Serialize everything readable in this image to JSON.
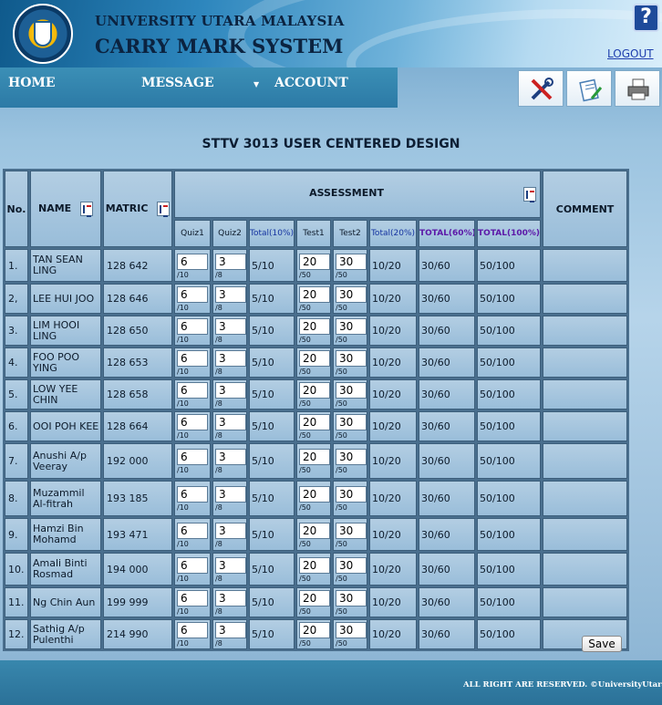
{
  "header": {
    "university": "UNIVERSITY UTARA MALAYSIA",
    "system": "CARRY MARK SYSTEM",
    "help_glyph": "?",
    "logout": "LOGOUT"
  },
  "nav": {
    "home": "HOME",
    "message": "MESSAGE",
    "account": "ACCOUNT"
  },
  "toolbar": {
    "icons": [
      "tools-icon",
      "document-edit-icon",
      "printer-icon"
    ]
  },
  "page": {
    "title": "STTV 3013 USER CENTERED DESIGN"
  },
  "table": {
    "headers": {
      "no": "No.",
      "name": "NAME",
      "matric": "MATRIC",
      "assessment": "ASSESSMENT",
      "comment": "COMMENT",
      "quiz1": "Quiz1",
      "quiz2": "Quiz2",
      "total10": "Total(10%)",
      "test1": "Test1",
      "test2": "Test2",
      "total20": "Total(20%)",
      "total60": "TOTAL(60%)",
      "total100": "TOTAL(100%)"
    },
    "max": {
      "quiz1": "/10",
      "quiz2": "/8",
      "test1": "/50",
      "test2": "/50"
    },
    "rows": [
      {
        "no": "1.",
        "name": "TAN SEAN LING",
        "matric": "128 642",
        "quiz1": "6",
        "quiz2": "3",
        "total10": "5/10",
        "test1": "20",
        "test2": "30",
        "total20": "10/20",
        "total60": "30/60",
        "total100": "50/100"
      },
      {
        "no": "2,",
        "name": "LEE HUI JOO",
        "matric": "128 646",
        "quiz1": "6",
        "quiz2": "3",
        "total10": "5/10",
        "test1": "20",
        "test2": "30",
        "total20": "10/20",
        "total60": "30/60",
        "total100": "50/100"
      },
      {
        "no": "3.",
        "name": "LIM HOOI LING",
        "matric": "128 650",
        "quiz1": "6",
        "quiz2": "3",
        "total10": "5/10",
        "test1": "20",
        "test2": "30",
        "total20": "10/20",
        "total60": "30/60",
        "total100": "50/100"
      },
      {
        "no": "4.",
        "name": "FOO POO YING",
        "matric": "128 653",
        "quiz1": "6",
        "quiz2": "3",
        "total10": "5/10",
        "test1": "20",
        "test2": "30",
        "total20": "10/20",
        "total60": "30/60",
        "total100": "50/100"
      },
      {
        "no": "5.",
        "name": "LOW YEE CHIN",
        "matric": "128 658",
        "quiz1": "6",
        "quiz2": "3",
        "total10": "5/10",
        "test1": "20",
        "test2": "30",
        "total20": "10/20",
        "total60": "30/60",
        "total100": "50/100"
      },
      {
        "no": "6.",
        "name": "OOI POH KEE",
        "matric": "128 664",
        "quiz1": "6",
        "quiz2": "3",
        "total10": "5/10",
        "test1": "20",
        "test2": "30",
        "total20": "10/20",
        "total60": "30/60",
        "total100": "50/100"
      },
      {
        "no": "7.",
        "name": "Anushi A/p Veeray",
        "matric": "192 000",
        "quiz1": "6",
        "quiz2": "3",
        "total10": "5/10",
        "test1": "20",
        "test2": "30",
        "total20": "10/20",
        "total60": "30/60",
        "total100": "50/100"
      },
      {
        "no": "8.",
        "name": "Muzammil Al-fitrah",
        "matric": "193 185",
        "quiz1": "6",
        "quiz2": "3",
        "total10": "5/10",
        "test1": "20",
        "test2": "30",
        "total20": "10/20",
        "total60": "30/60",
        "total100": "50/100"
      },
      {
        "no": "9.",
        "name": "Hamzi Bin Mohamd",
        "matric": "193 471",
        "quiz1": "6",
        "quiz2": "3",
        "total10": "5/10",
        "test1": "20",
        "test2": "30",
        "total20": "10/20",
        "total60": "30/60",
        "total100": "50/100"
      },
      {
        "no": "10.",
        "name": "Amali Binti Rosmad",
        "matric": "194 000",
        "quiz1": "6",
        "quiz2": "3",
        "total10": "5/10",
        "test1": "20",
        "test2": "30",
        "total20": "10/20",
        "total60": "30/60",
        "total100": "50/100"
      },
      {
        "no": "11.",
        "name": "Ng Chin Aun",
        "matric": "199 999",
        "quiz1": "6",
        "quiz2": "3",
        "total10": "5/10",
        "test1": "20",
        "test2": "30",
        "total20": "10/20",
        "total60": "30/60",
        "total100": "50/100"
      },
      {
        "no": "12.",
        "name": "Sathig A/p Pulenthi",
        "matric": "214 990",
        "quiz1": "6",
        "quiz2": "3",
        "total10": "5/10",
        "test1": "20",
        "test2": "30",
        "total20": "10/20",
        "total60": "30/60",
        "total100": "50/100"
      }
    ]
  },
  "actions": {
    "save": "Save"
  },
  "footer": {
    "text": "ALL RIGHT ARE RESERVED. ©UniversityUtara Malaysia"
  }
}
